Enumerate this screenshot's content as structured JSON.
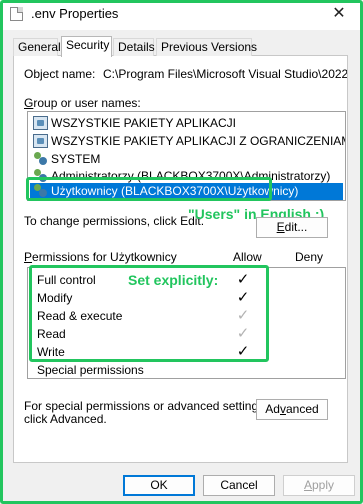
{
  "window": {
    "title": ".env Properties",
    "close_glyph": "✕"
  },
  "tabs": [
    {
      "label": "General",
      "active": false
    },
    {
      "label": "Security",
      "active": true
    },
    {
      "label": "Details",
      "active": false
    },
    {
      "label": "Previous Versions",
      "active": false
    }
  ],
  "object": {
    "label": "Object name:",
    "value": "C:\\Program Files\\Microsoft Visual Studio\\2022\\Pre"
  },
  "groups": {
    "label_pre": "",
    "label_u": "G",
    "label_post": "roup or user names:",
    "items": [
      {
        "name": "WSZYSTKIE PAKIETY APLIKACJI",
        "icon": "group-icon",
        "selected": false
      },
      {
        "name": "WSZYSTKIE PAKIETY APLIKACJI Z OGRANICZENIAMI",
        "icon": "group-icon",
        "selected": false
      },
      {
        "name": "SYSTEM",
        "icon": "users-icon",
        "selected": false
      },
      {
        "name": "Administratorzy (BLACKBOX3700X\\Administratorzy)",
        "icon": "users-icon",
        "selected": false
      },
      {
        "name": "Użytkownicy (BLACKBOX3700X\\Użytkownicy)",
        "icon": "users-icon",
        "selected": true
      }
    ]
  },
  "change_text": "To change permissions, click Edit.",
  "edit_button": {
    "pre": "",
    "u": "E",
    "post": "dit..."
  },
  "annotations": {
    "users_note": "\"Users\" in English ;)",
    "set_note": "Set explicitly:",
    "color": "#22c55e"
  },
  "permissions": {
    "label_pre": "",
    "label_u": "P",
    "label_post": "ermissions for Użytkownicy",
    "allow_header": "Allow",
    "deny_header": "Deny",
    "rows": [
      {
        "name": "Full control",
        "allow": "explicit"
      },
      {
        "name": "Modify",
        "allow": "explicit"
      },
      {
        "name": "Read & execute",
        "allow": "inherited"
      },
      {
        "name": "Read",
        "allow": "inherited"
      },
      {
        "name": "Write",
        "allow": "explicit"
      },
      {
        "name": "Special permissions",
        "allow": "none"
      }
    ],
    "check_glyph": "✓"
  },
  "advanced": {
    "text_line1": "For special permissions or advanced settings,",
    "text_line2": "click Advanced.",
    "button": {
      "pre": "Ad",
      "u": "v",
      "post": "anced"
    }
  },
  "footer": {
    "ok": "OK",
    "cancel": "Cancel",
    "apply_pre": "",
    "apply_u": "A",
    "apply_post": "pply"
  },
  "colors": {
    "accent_green": "#22c55e",
    "selection_blue": "#0078d7"
  }
}
